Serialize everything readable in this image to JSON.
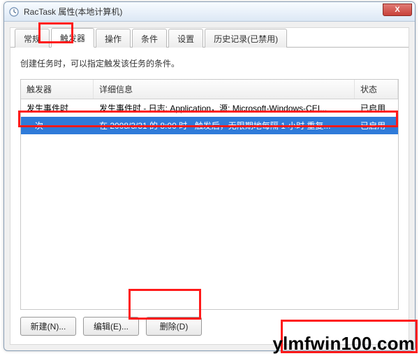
{
  "window": {
    "title": "RacTask 属性(本地计算机)",
    "close_glyph": "X"
  },
  "tabs": [
    {
      "label": "常规"
    },
    {
      "label": "触发器"
    },
    {
      "label": "操作"
    },
    {
      "label": "条件"
    },
    {
      "label": "设置"
    },
    {
      "label": "历史记录(已禁用)"
    }
  ],
  "description": "创建任务时，可以指定触发该任务的条件。",
  "columns": {
    "trigger": "触发器",
    "detail": "详细信息",
    "status": "状态"
  },
  "rows": [
    {
      "trigger": "发生事件时",
      "detail": "发生事件时 - 日志: Application，源: Microsoft-Windows-CEI...",
      "status": "已启用",
      "selected": false
    },
    {
      "trigger": "一次",
      "detail": "在 2008/3/31 的 8:00 时 - 触发后，无限期地每隔 1 小时 重复...",
      "status": "已启用",
      "selected": true
    }
  ],
  "buttons": {
    "new": "新建(N)...",
    "edit": "编辑(E)...",
    "delete": "删除(D)"
  },
  "watermark": "ylmfwin100.com"
}
